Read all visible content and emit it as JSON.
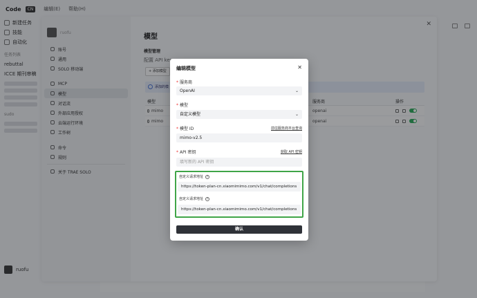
{
  "app": {
    "title": "Code",
    "badge": "CN",
    "menu": [
      "编辑(E)",
      "帮助(H)"
    ]
  },
  "left_sidebar": {
    "items": [
      {
        "label": "新建任务",
        "icon": "new-task-icon"
      },
      {
        "label": "技能",
        "icon": "skill-icon"
      },
      {
        "label": "自动化",
        "icon": "automation-icon"
      }
    ],
    "section": "任务列表",
    "project": "rebuttal",
    "task": "ICCE 期刊审稿",
    "section2": "sudo",
    "user": "ruofu"
  },
  "settings": {
    "nav": [
      {
        "label": "账号",
        "icon": "account-icon"
      },
      {
        "label": "通用",
        "icon": "general-icon"
      },
      {
        "label": "SOLO 移动端",
        "icon": "mobile-icon"
      },
      {
        "label": "MCP",
        "icon": "mcp-icon"
      },
      {
        "label": "模型",
        "icon": "model-icon"
      },
      {
        "label": "对话流",
        "icon": "dialog-icon"
      },
      {
        "label": "外部应用授权",
        "icon": "auth-icon"
      },
      {
        "label": "云端运行环境",
        "icon": "cloud-icon"
      },
      {
        "label": "工作树",
        "icon": "worktree-icon"
      },
      {
        "label": "命令",
        "icon": "command-icon"
      },
      {
        "label": "规则",
        "icon": "rules-icon"
      },
      {
        "label": "关于 TRAE SOLO",
        "icon": "about-icon"
      }
    ],
    "profile_name": "ruofu",
    "title": "模型",
    "subtitle": "模型管理",
    "desc": "配置 API key",
    "add_button": "添加模型",
    "info": "添加的模",
    "table": {
      "headers": {
        "model": "模型",
        "provider": "服务商",
        "ops": "操作"
      },
      "rows": [
        {
          "model": "mimo",
          "provider": "openai"
        },
        {
          "model": "mimo",
          "provider": "openai"
        }
      ]
    }
  },
  "modal": {
    "title": "编辑模型",
    "provider_label": "服务商",
    "provider_value": "OpenAI",
    "model_label": "模型",
    "model_value": "自定义模型",
    "model_id_label": "模型 ID",
    "model_id_link": "前往服务商平台查询",
    "model_id_value": "mimo-v2.5",
    "api_key_label": "API 密钥",
    "api_key_link": "获取 API 密钥",
    "api_key_placeholder": "填写新的 API 密钥",
    "custom_url_label_1": "自定义请求地址",
    "custom_url_value_1": "https://token-plan-cn.xiaomimimo.com/v1/chat/completions",
    "custom_url_label_2": "自定义请求地址",
    "custom_url_value_2": "https://token-plan-cn.xiaomimimo.com/v1/chat/completions",
    "confirm": "确认",
    "required_mark": "*",
    "help_mark": "?"
  },
  "colors": {
    "accent_green": "#3fa447",
    "toggle_green": "#2bab5b",
    "confirm_bg": "#2f3238"
  }
}
